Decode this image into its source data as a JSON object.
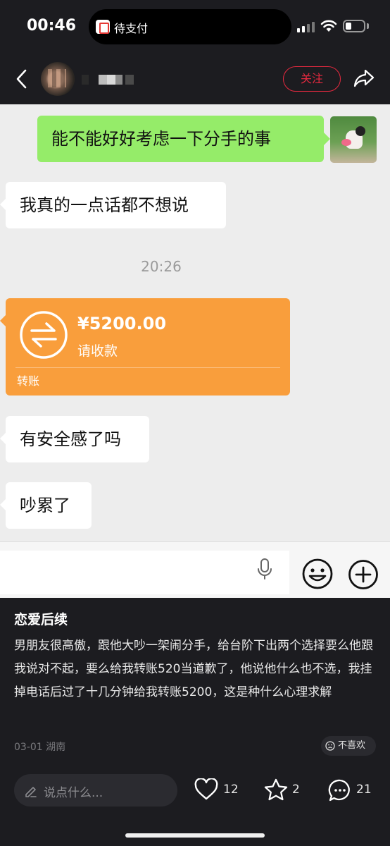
{
  "status_bar": {
    "time": "00:46",
    "island_label": "待支付"
  },
  "nav": {
    "follow_label": "关注"
  },
  "chat": {
    "my_message": "能不能好好考虑一下分手的事",
    "messages": [
      "我真的一点话都不想说",
      "有安全感了吗",
      "吵累了"
    ],
    "timestamp": "20:26",
    "transfer": {
      "amount": "¥5200.00",
      "subtitle": "请收款",
      "type": "转账",
      "color": "#f99e3c"
    },
    "my_bubble_color": "#95ec69"
  },
  "post": {
    "title": "恋爱后续",
    "body": "男朋友很高傲，跟他大吵一架闹分手，给台阶下出两个选择要么他跟我说对不起，要么给我转账520当道歉了，他说他什么也不选，我挂掉电话后过了十几分钟给我转账5200，这是种什么心理求解",
    "meta": "03-01 湖南",
    "dislike_label": "不喜欢"
  },
  "actions": {
    "comment_placeholder": "说点什么...",
    "likes": "12",
    "favorites": "2",
    "comments": "21"
  },
  "colors": {
    "accent_red": "#e6293f",
    "background_dark": "#1c1c20"
  }
}
